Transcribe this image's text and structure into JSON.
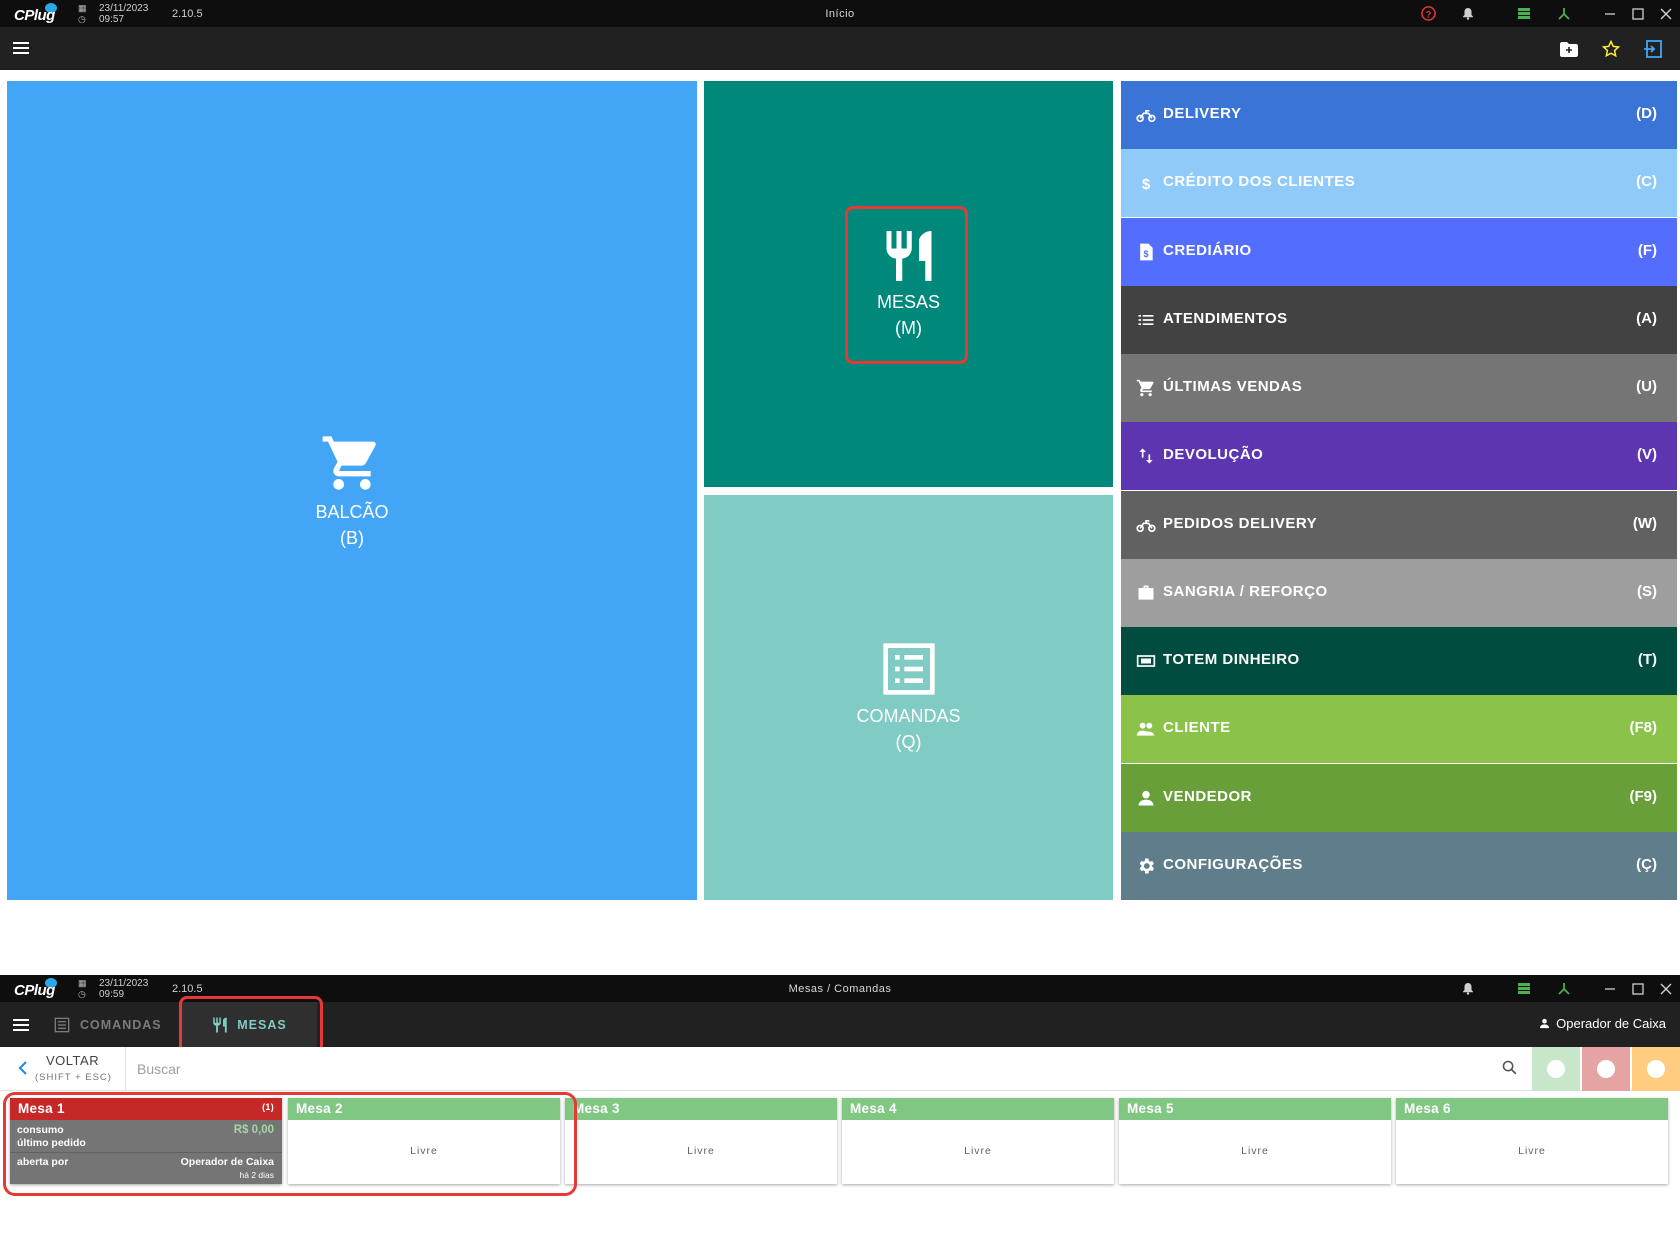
{
  "screen1": {
    "titlebar": {
      "date": "23/11/2023",
      "time": "09:57",
      "version": "2.10.5",
      "title": "Início",
      "logo": "CPlug"
    },
    "tiles": [
      {
        "label": "BALCÃO",
        "key": "(B)"
      },
      {
        "label": "MESAS",
        "key": "(M)"
      },
      {
        "label": "COMANDAS",
        "key": "(Q)"
      }
    ],
    "menu": [
      {
        "label": "DELIVERY",
        "key": "(D)",
        "icon": "motorcycle-icon",
        "color": "#3a74d6"
      },
      {
        "label": "CRÉDITO DOS CLIENTES",
        "key": "(C)",
        "icon": "dollar-icon",
        "color": "#90caf9"
      },
      {
        "label": "CREDIÁRIO",
        "key": "(F)",
        "icon": "document-dollar-icon",
        "color": "#536dfe"
      },
      {
        "label": "ATENDIMENTOS",
        "key": "(A)",
        "icon": "list-icon",
        "color": "#424242"
      },
      {
        "label": "ÚLTIMAS VENDAS",
        "key": "(U)",
        "icon": "cart-icon",
        "color": "#757575"
      },
      {
        "label": "DEVOLUÇÃO",
        "key": "(V)",
        "icon": "swap-vertical-icon",
        "color": "#5e35b1"
      },
      {
        "label": "PEDIDOS DELIVERY",
        "key": "(W)",
        "icon": "motorcycle-icon",
        "color": "#616161"
      },
      {
        "label": "SANGRIA / REFORÇO",
        "key": "(S)",
        "icon": "briefcase-icon",
        "color": "#9e9e9e"
      },
      {
        "label": "TOTEM DINHEIRO",
        "key": "(T)",
        "icon": "cash-icon",
        "color": "#004d40"
      },
      {
        "label": "CLIENTE",
        "key": "(F8)",
        "icon": "people-icon",
        "color": "#8bc34a"
      },
      {
        "label": "VENDEDOR",
        "key": "(F9)",
        "icon": "person-icon",
        "color": "#689f38"
      },
      {
        "label": "CONFIGURAÇÕES",
        "key": "(Ç)",
        "icon": "gear-icon",
        "color": "#607d8b"
      }
    ]
  },
  "screen2": {
    "titlebar": {
      "date": "23/11/2023",
      "time": "09:59",
      "version": "2.10.5",
      "title": "Mesas / Comandas",
      "logo": "CPlug"
    },
    "tabs": {
      "comandas": "COMANDAS",
      "mesas": "MESAS"
    },
    "operator": "Operador de Caixa",
    "back": {
      "label": "VOLTAR",
      "shortcut": "(SHIFT + ESC)"
    },
    "search": {
      "placeholder": "Buscar"
    },
    "filters": [
      {
        "color": "#c8e6c9"
      },
      {
        "color": "#e6a3a3"
      },
      {
        "color": "#ffcc80"
      }
    ],
    "mesa1": {
      "name": "Mesa 1",
      "count": "(1)",
      "consumo_label": "consumo",
      "consumo_value": "R$ 0,00",
      "ultimo_label": "último pedido",
      "aberta_label": "aberta por",
      "aberta_value": "Operador de Caixa",
      "aberta_when": "há 2 dias"
    },
    "mesas": [
      {
        "name": "Mesa 2",
        "status": "Livre"
      },
      {
        "name": "Mesa 3",
        "status": "Livre"
      },
      {
        "name": "Mesa 4",
        "status": "Livre"
      },
      {
        "name": "Mesa 5",
        "status": "Livre"
      },
      {
        "name": "Mesa 6",
        "status": "Livre"
      }
    ]
  }
}
